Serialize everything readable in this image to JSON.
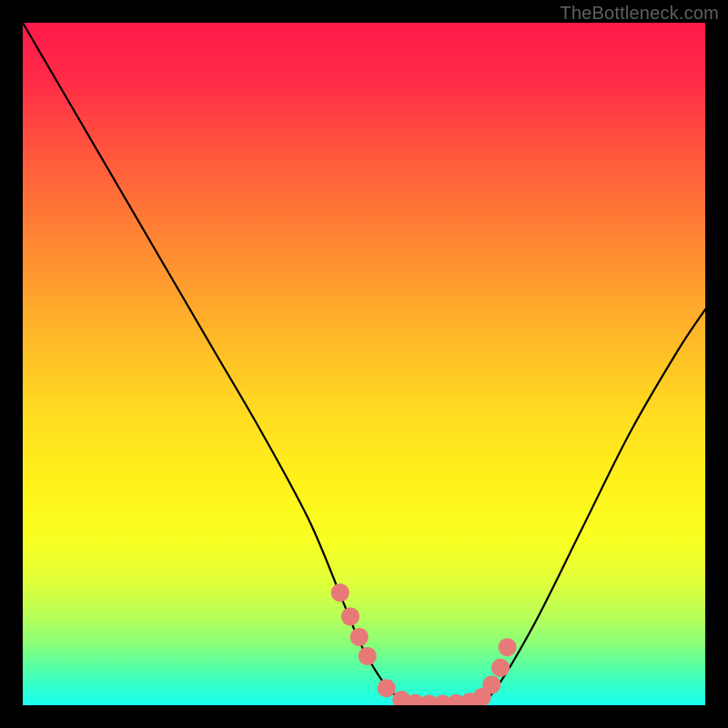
{
  "watermark": "TheBottleneck.com",
  "chart_data": {
    "type": "line",
    "title": "",
    "xlabel": "",
    "ylabel": "",
    "xlim": [
      0,
      100
    ],
    "ylim": [
      0,
      100
    ],
    "grid": false,
    "series": [
      {
        "name": "curve",
        "x": [
          0,
          7,
          14,
          21,
          28,
          35,
          42,
          47,
          50,
          54,
          58,
          62,
          66,
          69,
          75,
          82,
          89,
          96,
          100
        ],
        "values": [
          100,
          88,
          76,
          64,
          52,
          40,
          27,
          15,
          8,
          2,
          0,
          0,
          0,
          2,
          12,
          26,
          40,
          52,
          58
        ]
      }
    ],
    "markers": {
      "name": "highlight-dots",
      "color": "#e77a78",
      "radius": 10,
      "x": [
        46.5,
        48.0,
        49.3,
        50.5,
        53.3,
        55.5,
        57.5,
        59.5,
        61.5,
        63.5,
        65.5,
        67.3,
        68.7,
        70.0,
        71.0
      ],
      "values": [
        16.5,
        13.0,
        10.0,
        7.2,
        2.5,
        0.8,
        0.3,
        0.2,
        0.2,
        0.3,
        0.5,
        1.2,
        3.0,
        5.5,
        8.5
      ]
    },
    "background": {
      "type": "vertical-gradient",
      "stops": [
        {
          "pos": 0.0,
          "color": "#ff1a4b"
        },
        {
          "pos": 0.5,
          "color": "#ffde20"
        },
        {
          "pos": 0.8,
          "color": "#dfff3a"
        },
        {
          "pos": 1.0,
          "color": "#1affef"
        }
      ]
    }
  }
}
